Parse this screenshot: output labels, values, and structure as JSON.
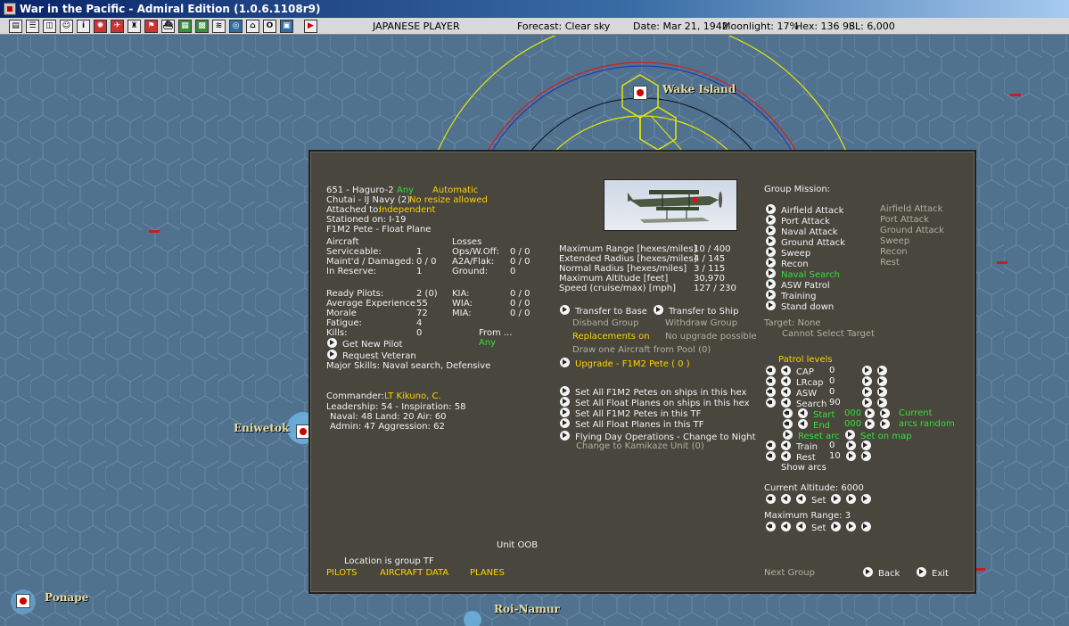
{
  "window": {
    "title": "War in the Pacific - Admiral Edition (1.0.6.1108r9)"
  },
  "toolbar": {
    "buttons": [
      "document",
      "list",
      "airbase",
      "pilot",
      "info",
      "rising-sun-flag",
      "airgroup",
      "unit",
      "flag",
      "ship",
      "oob",
      "map",
      "ships",
      "globe",
      "reports",
      "ops",
      "combat",
      "end-turn"
    ],
    "player": "JAPANESE PLAYER",
    "forecast": "Forecast: Clear sky",
    "date": "Date: Mar 21, 1942",
    "moonlight": "Moonlight: 17%",
    "hex": "Hex: 136 98",
    "sl": "SL: 6,000"
  },
  "map": {
    "places": {
      "wake": "Wake Island",
      "eniwetok": "Eniwetok",
      "ponape": "Ponape",
      "roi": "Roi-Namur"
    },
    "colors": {
      "ocean": "#50728f",
      "hexgrid": "#6a8aa6",
      "range_yellow": "#e6e600",
      "range_red": "#d02020"
    }
  },
  "group": {
    "name": "651 - Haguro-2",
    "filter": "Any",
    "mode": "Automatic",
    "unit_line": "Chutai - IJ Navy (2)",
    "resize": "No resize allowed",
    "attached_label": "Attached to:",
    "attached_value": "Independent",
    "stationed": "Stationed on: I-19",
    "aircraft_type": "F1M2 Pete - Float Plane"
  },
  "aircraft": {
    "header": "Aircraft",
    "rows": [
      {
        "label": "Serviceable:",
        "value": "1"
      },
      {
        "label": "Maint'd / Damaged:",
        "value": "0 / 0"
      },
      {
        "label": "In Reserve:",
        "value": "1"
      }
    ]
  },
  "losses": {
    "header": "Losses",
    "rows": [
      {
        "label": "Ops/W.Off:",
        "value": "0 / 0"
      },
      {
        "label": "A2A/Flak:",
        "value": "0 / 0"
      },
      {
        "label": "Ground:",
        "value": "0"
      }
    ]
  },
  "pilots": {
    "rows": [
      {
        "label": "Ready Pilots:",
        "value": "2 (0)"
      },
      {
        "label": "Average Experience",
        "value": "55"
      },
      {
        "label": "Morale",
        "value": "72"
      },
      {
        "label": "Fatigue:",
        "value": "4"
      },
      {
        "label": "Kills:",
        "value": "0"
      }
    ],
    "casualties": [
      {
        "label": "KIA:",
        "value": "0 / 0"
      },
      {
        "label": "WIA:",
        "value": "0 / 0"
      },
      {
        "label": "MIA:",
        "value": "0 / 0"
      }
    ],
    "from_label": "From ...",
    "from_value": "Any",
    "get_new": "Get New Pilot",
    "request_veteran": "Request Veteran",
    "skills": "Major Skills: Naval search, Defensive"
  },
  "commander": {
    "label": "Commander:",
    "name": "LT Kikuno, C.",
    "line1": "Leadership: 54 - Inspiration: 58",
    "line2": "Naval: 48  Land: 20  Air: 60",
    "line3": "Admin: 47  Aggression: 62"
  },
  "performance": {
    "rows": [
      {
        "label": "Maximum Range [hexes/miles]",
        "value": "10 / 400"
      },
      {
        "label": "Extended Radius [hexes/miles]",
        "value": "4 / 145"
      },
      {
        "label": "Normal Radius [hexes/miles]",
        "value": "3 / 115"
      },
      {
        "label": "Maximum Altitude [feet]",
        "value": "30,970"
      },
      {
        "label": "Speed (cruise/max) [mph]",
        "value": "127 / 230"
      }
    ]
  },
  "actions": {
    "transfer_base": "Transfer to Base",
    "transfer_ship": "Transfer to Ship",
    "disband": "Disband Group",
    "withdraw": "Withdraw Group",
    "replacements": "Replacements on",
    "no_upgrade": "No upgrade possible",
    "draw_one": "Draw one Aircraft from Pool (0)",
    "upgrade": "Upgrade - F1M2 Pete  ( 0 )",
    "set_all_hex": "Set All F1M2 Petes on ships in this hex",
    "set_float_hex": "Set All Float Planes on ships in this hex",
    "set_all_tf": "Set All F1M2 Petes in this TF",
    "set_float_tf": "Set All Float Planes in this TF",
    "flying_day": "Flying Day Operations - Change to Night",
    "kamikaze": "Change to Kamikaze Unit (0)"
  },
  "mission": {
    "header": "Group Mission:",
    "options": [
      "Airfield Attack",
      "Port Attack",
      "Naval Attack",
      "Ground Attack",
      "Sweep",
      "Recon",
      "Naval Search",
      "ASW Patrol",
      "Training",
      "Stand down"
    ],
    "secondary": [
      "Airfield Attack",
      "Port Attack",
      "Ground Attack",
      "Sweep",
      "Recon",
      "Rest"
    ],
    "selected": "Naval Search",
    "target": "Target: None",
    "cannot_select": "Cannot Select Target"
  },
  "patrol": {
    "header": "Patrol levels",
    "rows": [
      {
        "label": "CAP",
        "value": "0"
      },
      {
        "label": "LRcap",
        "value": "0"
      },
      {
        "label": "ASW",
        "value": "0"
      },
      {
        "label": "Search",
        "value": "90"
      }
    ],
    "start_label": "Start",
    "start_value": "000",
    "end_label": "End",
    "end_value": "000",
    "current": "Current",
    "arcs_random": "arcs random",
    "reset_arc": "Reset arc",
    "set_on_map": "Set on map",
    "train_label": "Train",
    "train_value": "0",
    "rest_label": "Rest",
    "rest_value": "10",
    "show_arcs": "Show arcs"
  },
  "altitude": {
    "label": "Current Altitude: 6000",
    "set": "Set"
  },
  "max_range": {
    "label": "Maximum Range: 3",
    "set": "Set"
  },
  "footer": {
    "unit_oob": "Unit OOB",
    "location": "Location is group TF",
    "pilots": "PILOTS",
    "aircraft_data": "AIRCRAFT DATA",
    "planes": "PLANES",
    "next_group": "Next Group",
    "back": "Back",
    "exit": "Exit"
  }
}
